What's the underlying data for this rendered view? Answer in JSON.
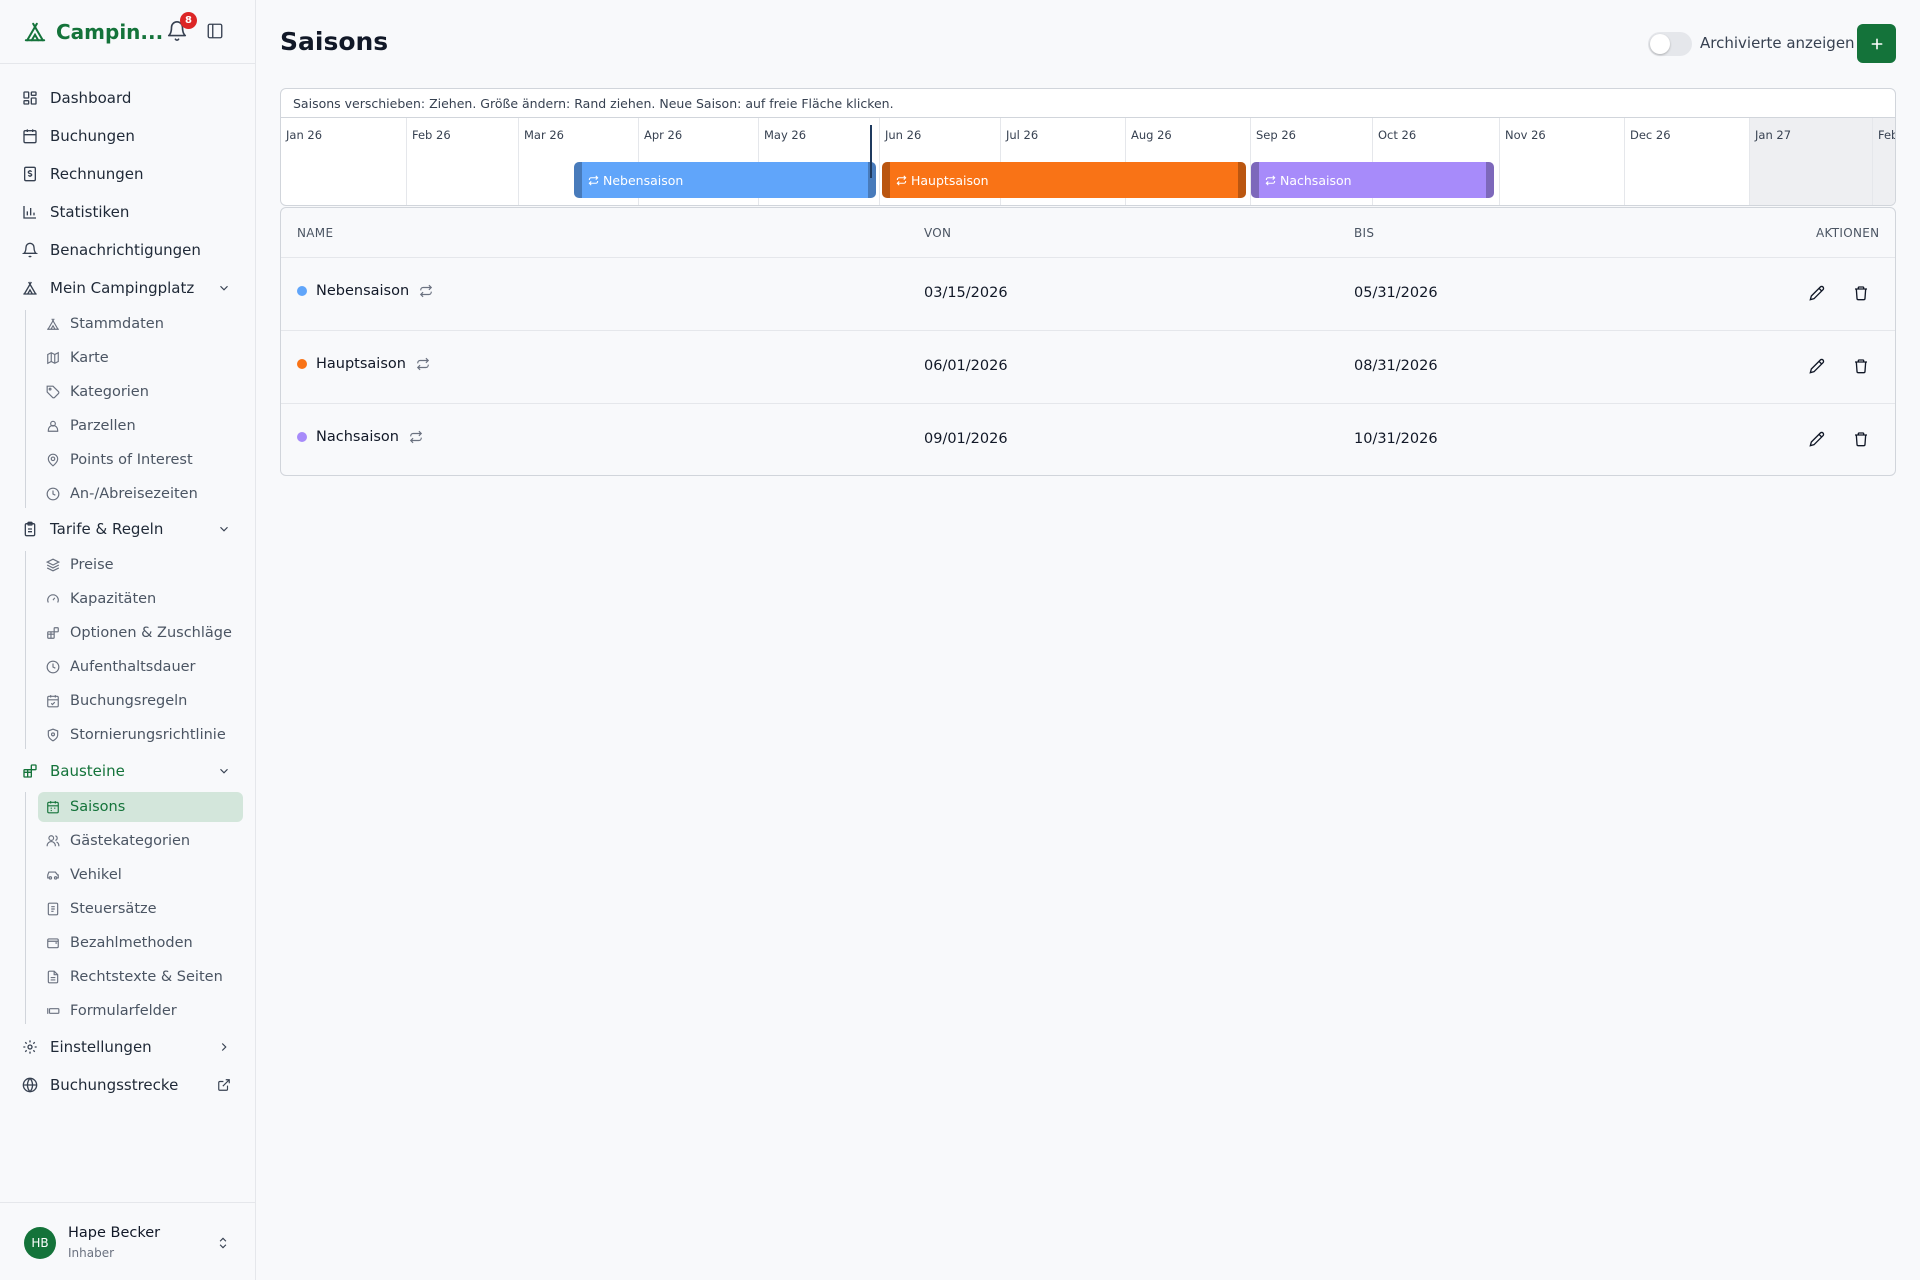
{
  "app": {
    "name": "Campin..."
  },
  "notifications": {
    "count": "8"
  },
  "sidebar": {
    "top_items": [
      {
        "label": "Dashboard",
        "icon": "dashboard-icon"
      },
      {
        "label": "Buchungen",
        "icon": "calendar-icon"
      },
      {
        "label": "Rechnungen",
        "icon": "invoice-icon"
      },
      {
        "label": "Statistiken",
        "icon": "bar-chart-icon"
      },
      {
        "label": "Benachrichtigungen",
        "icon": "bell-icon"
      }
    ],
    "group_campsite": {
      "label": "Mein Campingplatz",
      "items": [
        "Stammdaten",
        "Karte",
        "Kategorien",
        "Parzellen",
        "Points of Interest",
        "An-/Abreisezeiten"
      ]
    },
    "group_rates": {
      "label": "Tarife & Regeln",
      "items": [
        "Preise",
        "Kapazitäten",
        "Optionen & Zuschläge",
        "Aufenthaltsdauer",
        "Buchungsregeln",
        "Stornierungsrichtlinie"
      ]
    },
    "group_blocks": {
      "label": "Bausteine",
      "items": [
        "Saisons",
        "Gästekategorien",
        "Vehikel",
        "Steuersätze",
        "Bezahlmethoden",
        "Rechtstexte & Seiten",
        "Formularfelder"
      ]
    },
    "settings": "Einstellungen",
    "booking_flow": "Buchungsstrecke"
  },
  "user": {
    "initials": "HB",
    "name": "Hape Becker",
    "role": "Inhaber"
  },
  "header": {
    "title": "Saisons",
    "toggle_label": "Archivierte anzeigen",
    "toggle_on": false
  },
  "timeline": {
    "hint": "Saisons verschieben: Ziehen. Größe ändern: Rand ziehen. Neue Saison: auf freie Fläche klicken.",
    "months": [
      "Jan 26",
      "Feb 26",
      "Mar 26",
      "Apr 26",
      "May 26",
      "Jun 26",
      "Jul 26",
      "Aug 26",
      "Sep 26",
      "Oct 26",
      "Nov 26",
      "Dec 26",
      "Jan 27",
      "Feb"
    ]
  },
  "table": {
    "headers": {
      "name": "NAME",
      "from": "VON",
      "to": "BIS",
      "actions": "AKTIONEN"
    },
    "rows": [
      {
        "name": "Nebensaison",
        "from": "03/15/2026",
        "to": "05/31/2026",
        "color": "#60a5fa"
      },
      {
        "name": "Hauptsaison",
        "from": "06/01/2026",
        "to": "08/31/2026",
        "color": "#f97316"
      },
      {
        "name": "Nachsaison",
        "from": "09/01/2026",
        "to": "10/31/2026",
        "color": "#a78bfa"
      }
    ]
  },
  "colors": {
    "brand": "#14733a",
    "badge": "#dc2626"
  }
}
